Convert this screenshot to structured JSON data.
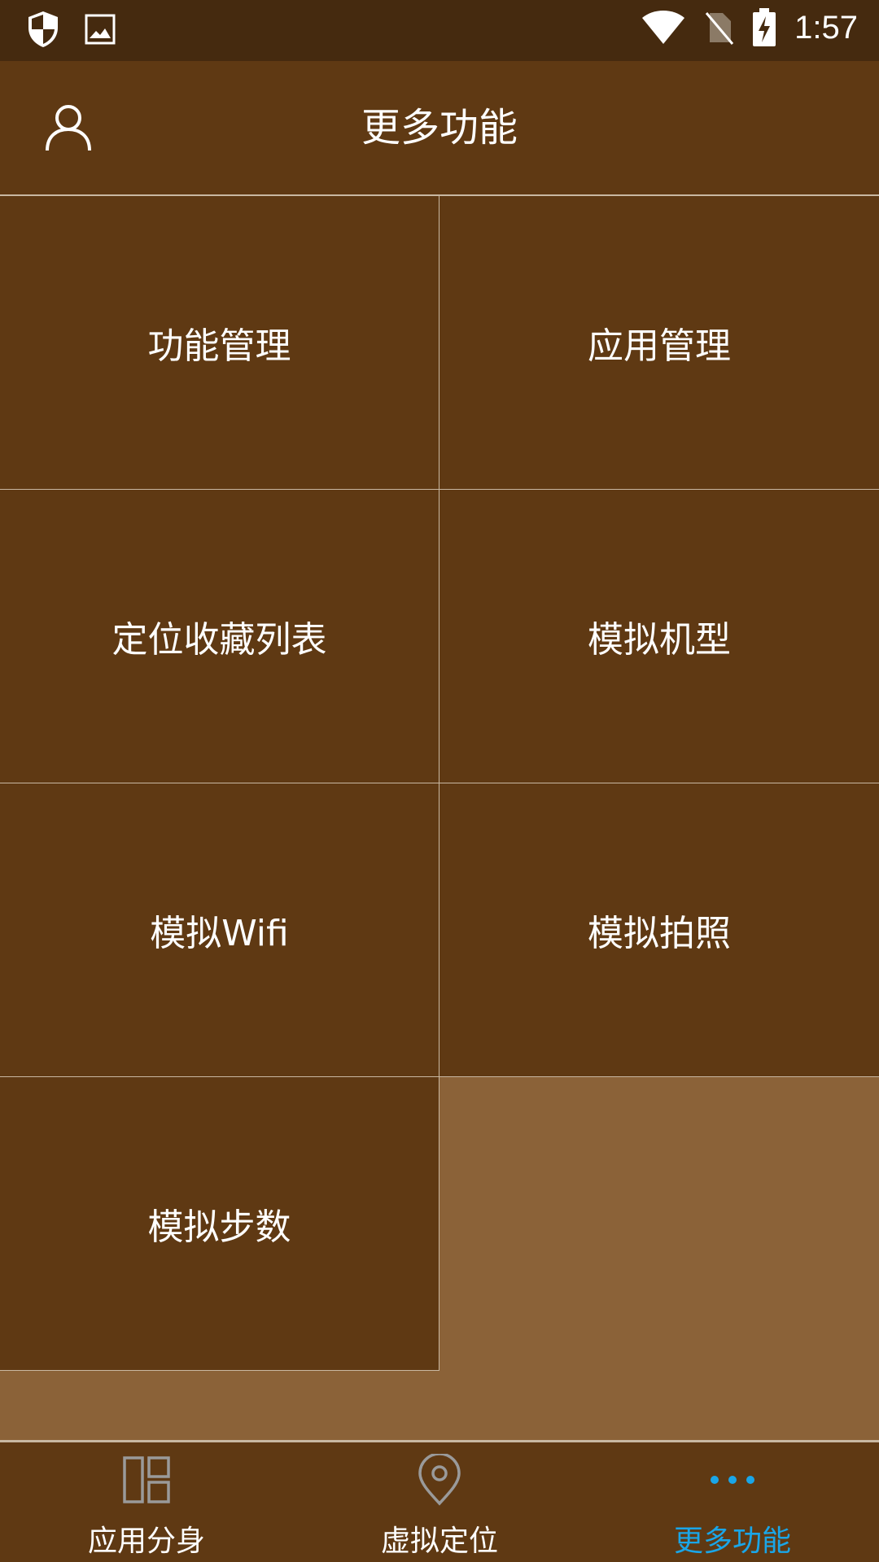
{
  "status_bar": {
    "time": "1:57",
    "left_icons": [
      "shield-icon",
      "image-icon"
    ],
    "right_icons": [
      "wifi-icon",
      "no-sim-icon",
      "battery-charging-icon"
    ]
  },
  "header": {
    "title": "更多功能",
    "profile_icon": "person-icon"
  },
  "grid": {
    "items": [
      {
        "label": "功能管理"
      },
      {
        "label": "应用管理"
      },
      {
        "label": "定位收藏列表"
      },
      {
        "label": "模拟机型"
      },
      {
        "label": "模拟Wifi"
      },
      {
        "label": "模拟拍照"
      },
      {
        "label": "模拟步数"
      }
    ]
  },
  "bottom_nav": {
    "items": [
      {
        "label": "应用分身",
        "icon": "layout-icon",
        "active": false
      },
      {
        "label": "虚拟定位",
        "icon": "location-pin-icon",
        "active": false
      },
      {
        "label": "更多功能",
        "icon": "more-dots-icon",
        "active": true
      }
    ]
  },
  "colors": {
    "status_bar": "#452a0f",
    "primary": "#5f3913",
    "background": "#8b6238",
    "divider": "#c9b8a2",
    "active": "#1aa6e8",
    "inactive_icon": "#9a9a9a"
  }
}
